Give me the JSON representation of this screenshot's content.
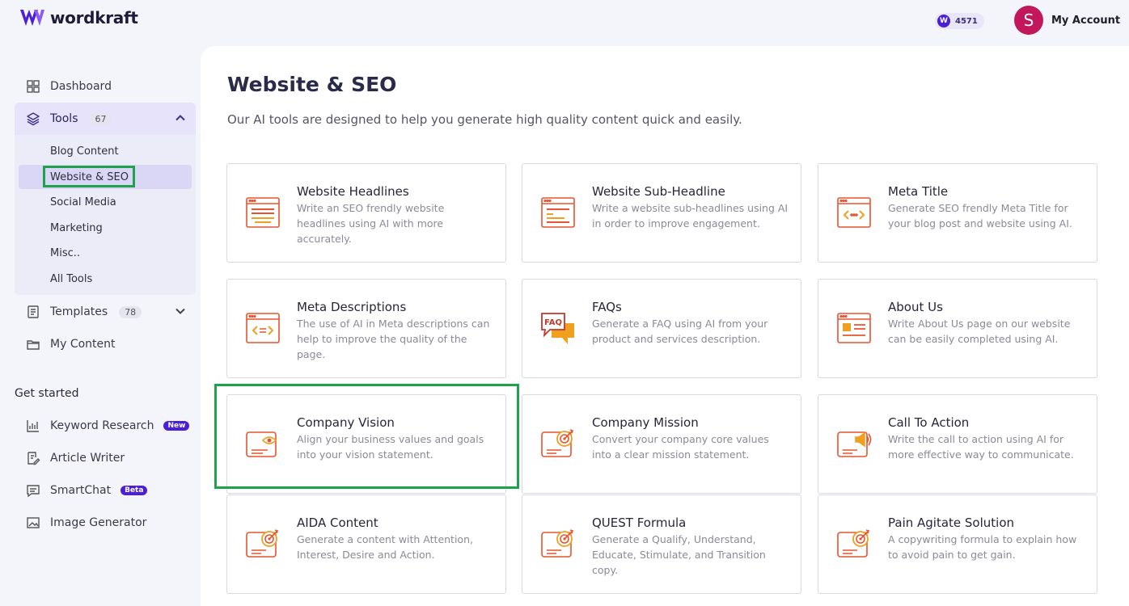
{
  "header": {
    "brand": "wordkraft",
    "credits_badge": "W",
    "credits": "4571",
    "avatar_initial": "S",
    "account_label": "My Account"
  },
  "sidebar": {
    "dashboard": "Dashboard",
    "tools": {
      "label": "Tools",
      "count": "67"
    },
    "tools_submenu": [
      "Blog Content",
      "Website & SEO",
      "Social Media",
      "Marketing",
      "Misc..",
      "All Tools"
    ],
    "templates": {
      "label": "Templates",
      "count": "78"
    },
    "my_content": "My Content",
    "get_started_label": "Get started",
    "get_started": [
      {
        "label": "Keyword Research",
        "tag": "New"
      },
      {
        "label": "Article Writer",
        "tag": ""
      },
      {
        "label": "SmartChat",
        "tag": "Beta"
      },
      {
        "label": "Image Generator",
        "tag": ""
      }
    ]
  },
  "main": {
    "title": "Website & SEO",
    "subtitle": "Our AI tools are designed to help you generate high quality content quick and easily.",
    "cards": [
      {
        "title": "Website Headlines",
        "desc": "Write an SEO frendly website headlines using AI with more accurately.",
        "icon": "browser-headline-icon"
      },
      {
        "title": "Website Sub-Headline",
        "desc": "Write a website sub-headlines using AI in order to improve engagement.",
        "icon": "browser-subheadline-icon"
      },
      {
        "title": "Meta Title",
        "desc": "Generate SEO frendly Meta Title for your blog post and website using AI.",
        "icon": "browser-code-icon"
      },
      {
        "title": "Meta Descriptions",
        "desc": "The use of AI in Meta descriptions can help to improve the quality of the page.",
        "icon": "browser-code-icon"
      },
      {
        "title": "FAQs",
        "desc": "Generate a FAQ using AI from your product and services description.",
        "icon": "faq-bubble-icon"
      },
      {
        "title": "About Us",
        "desc": "Write About Us page on our website can be easily completed using AI.",
        "icon": "browser-about-icon"
      },
      {
        "title": "Company Vision",
        "desc": "Align your business values and goals into your vision statement.",
        "icon": "vision-eye-icon"
      },
      {
        "title": "Company Mission",
        "desc": "Convert your company core values into a clear mission statement.",
        "icon": "target-icon"
      },
      {
        "title": "Call To Action",
        "desc": "Write the call to action using AI for more effective way to communicate.",
        "icon": "megaphone-icon"
      },
      {
        "title": "AIDA Content",
        "desc": "Generate a content with Attention, Interest, Desire and Action.",
        "icon": "target-icon"
      },
      {
        "title": "QUEST Formula",
        "desc": "Generate a Qualify, Understand, Educate, Stimulate, and Transition copy.",
        "icon": "target-icon"
      },
      {
        "title": "Pain Agitate Solution",
        "desc": "A copywriting formula to explain how to avoid pain to get gain.",
        "icon": "target-icon"
      }
    ]
  },
  "colors": {
    "accent": "#4b1fd6",
    "icon_orange": "#e8542f",
    "icon_gold": "#f0a020",
    "highlight_green": "#1fa34a"
  }
}
